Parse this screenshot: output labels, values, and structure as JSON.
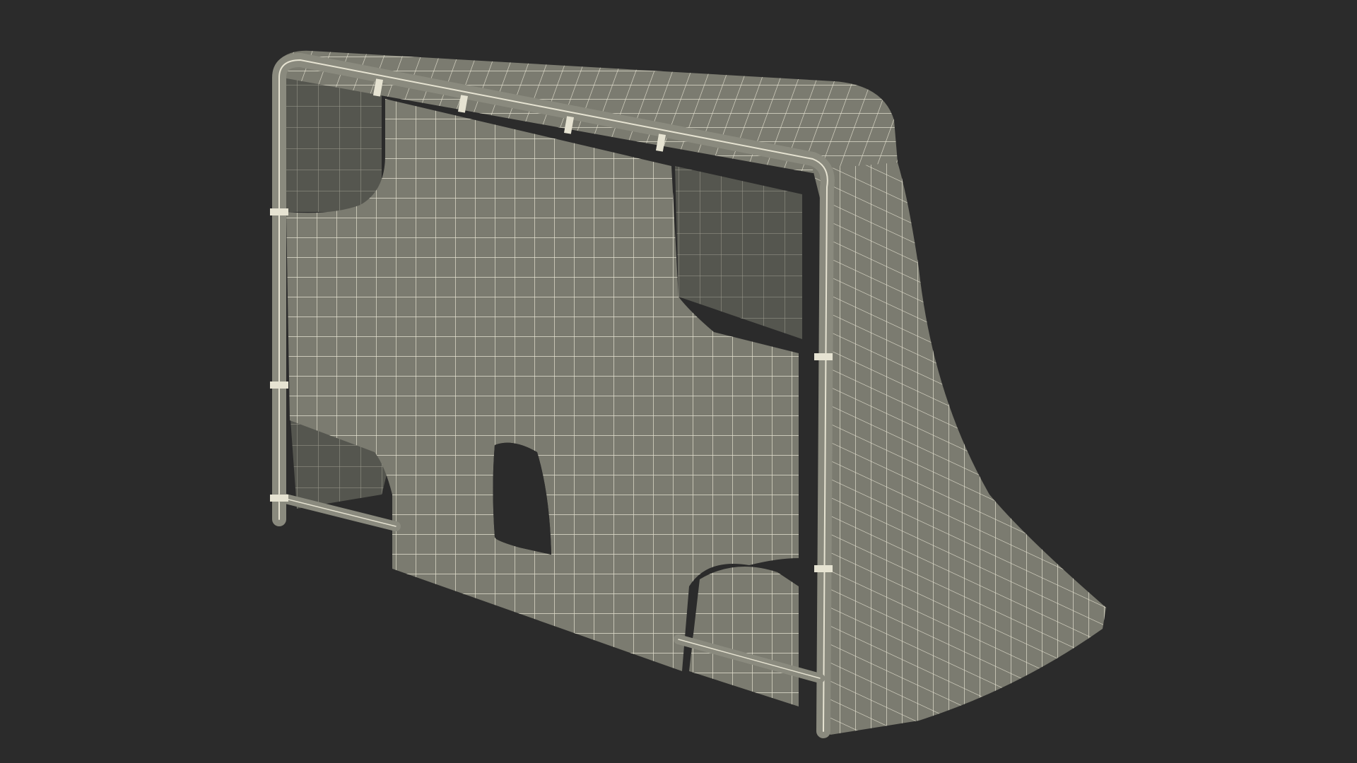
{
  "scene": {
    "subject": "goal-frame-with-target-panel",
    "render_mode": "wireframe-over-shaded",
    "colors": {
      "background": "#2b2b2b",
      "surface": "#7b7b70",
      "surface_dark": "#5e5f56",
      "interior": "#4a4b45",
      "wire": "#e6e3d2",
      "frame": "#8a8a7e",
      "hole": "#2b2b2b"
    }
  }
}
